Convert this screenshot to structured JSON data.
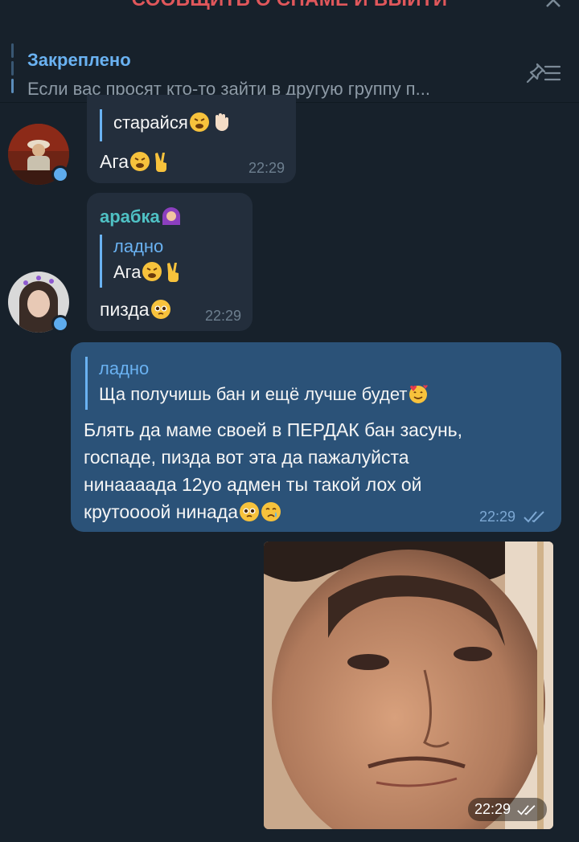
{
  "spam_bar": {
    "label": "СООБЩИТЬ О СПАМЕ И ВЫЙТИ"
  },
  "pinned": {
    "title": "Закреплено",
    "text": "Если вас просят кто-то зайти в другую группу п..."
  },
  "messages": [
    {
      "reply_text": "старайся",
      "text": "Ага",
      "time": "22:29",
      "reply_emoji": [
        "weary-face",
        "raised-hand"
      ],
      "emoji": [
        "weary-face",
        "victory-hand"
      ]
    },
    {
      "sender": "арабка",
      "reply_name": "ладно",
      "reply_text": "Ага",
      "text": "пизда",
      "time": "22:29",
      "sender_emoji": "woman-with-headscarf",
      "reply_emoji": [
        "weary-face",
        "victory-hand"
      ],
      "emoji": [
        "pleading-face"
      ]
    },
    {
      "reply_name": "ладно",
      "reply_text": "Ща получишь бан и ещё лучше будет",
      "text_lines": [
        "Блять да маме своей в ПЕРДАК бан засунь,",
        "госпаде, пизда вот эта да пажалуйста",
        "нинаааада 12уо адмен ты такой лох ой",
        "крутоооой нинада"
      ],
      "time": "22:29",
      "status": "read",
      "reply_emoji": [
        "smiling-face-with-hearts"
      ],
      "emoji": [
        "pleading-face",
        "crying-face"
      ]
    },
    {
      "type": "photo",
      "time": "22:29",
      "status": "read"
    }
  ],
  "colors": {
    "background": "#17212b",
    "incoming": "#232e3c",
    "outgoing": "#2b5278",
    "accent": "#6ab2f2",
    "spam": "#e0575b"
  }
}
